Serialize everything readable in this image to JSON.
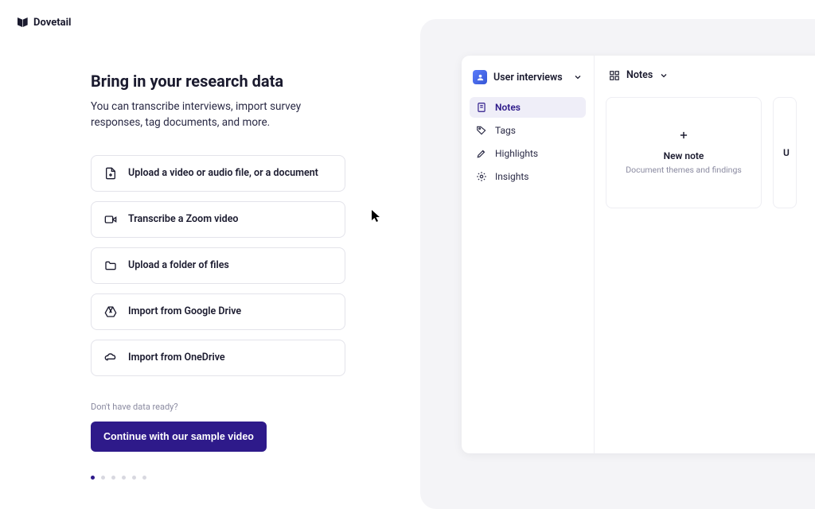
{
  "brand": "Dovetail",
  "header": {
    "title": "Bring in your research data",
    "subtitle": "You can transcribe interviews, import survey responses, tag documents, and more."
  },
  "options": [
    {
      "icon": "file-icon",
      "label": "Upload a video or audio file, or a document"
    },
    {
      "icon": "video-icon",
      "label": "Transcribe a Zoom video"
    },
    {
      "icon": "folder-icon",
      "label": "Upload a folder of files"
    },
    {
      "icon": "google-drive-icon",
      "label": "Import from Google Drive"
    },
    {
      "icon": "onedrive-icon",
      "label": "Import from OneDrive"
    }
  ],
  "hint": "Don't have data ready?",
  "cta_label": "Continue with our sample video",
  "pagination": {
    "total": 6,
    "active_index": 0
  },
  "preview": {
    "project_name": "User interviews",
    "nav": [
      {
        "icon": "note-icon",
        "label": "Notes",
        "active": true
      },
      {
        "icon": "tag-icon",
        "label": "Tags",
        "active": false
      },
      {
        "icon": "highlight-icon",
        "label": "Highlights",
        "active": false
      },
      {
        "icon": "insight-icon",
        "label": "Insights",
        "active": false
      }
    ],
    "view_selector_label": "Notes",
    "new_note": {
      "title": "New note",
      "subtitle": "Document themes and findings"
    },
    "peek_text": "U"
  }
}
